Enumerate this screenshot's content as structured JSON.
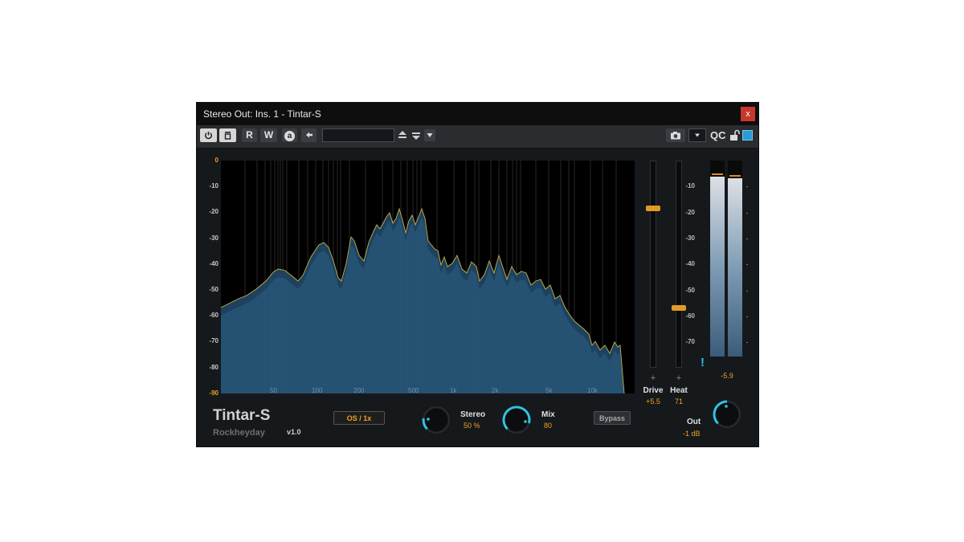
{
  "window": {
    "title": "Stereo Out: Ins. 1 - Tintar-S",
    "close_glyph": "x"
  },
  "toolbar": {
    "power_icon": "power-icon",
    "bypass_icon": "minimize-icon",
    "read_label": "R",
    "write_label": "W",
    "auto_label": "a",
    "back_icon": "arrow-left-icon",
    "preset_value": "",
    "camera_icon": "camera-icon",
    "qc_label": "QC"
  },
  "analyzer": {
    "y_ticks": [
      "0",
      "-10",
      "-20",
      "-30",
      "-40",
      "-50",
      "-60",
      "-70",
      "-80",
      "-90"
    ],
    "x_ticks": [
      "50",
      "100",
      "200",
      "500",
      "1k",
      "2k",
      "5k",
      "10k"
    ],
    "colors": {
      "fill": "#1f4563",
      "outline": "#c8b24a",
      "grid": "#3a3a3a",
      "axis_highlight": "#f0a21e"
    }
  },
  "faders": {
    "drive": {
      "label": "Drive",
      "value": "+5.5",
      "level": 0.77
    },
    "heat": {
      "label": "Heat",
      "value": "71",
      "level": 0.29
    }
  },
  "output_meter": {
    "ticks": [
      "-10",
      "-20",
      "-30",
      "-40",
      "-50",
      "-60",
      "-70"
    ],
    "peak_value": "-5.9",
    "clip_glyph": "!"
  },
  "plugin": {
    "name": "Tintar-S",
    "maker": "Rockheyday",
    "version": "v1.0"
  },
  "controls": {
    "oversampling": "OS / 1x",
    "stereo": {
      "label": "Stereo",
      "value": "50 %"
    },
    "mix": {
      "label": "Mix",
      "value": "80"
    },
    "bypass": "Bypass",
    "out": {
      "label": "Out",
      "value": "-1 dB"
    }
  },
  "colors": {
    "accent": "#f0a21e",
    "knob_arc": "#2ec4e0",
    "close": "#c8372d",
    "link_square": "#2a9bd6"
  }
}
